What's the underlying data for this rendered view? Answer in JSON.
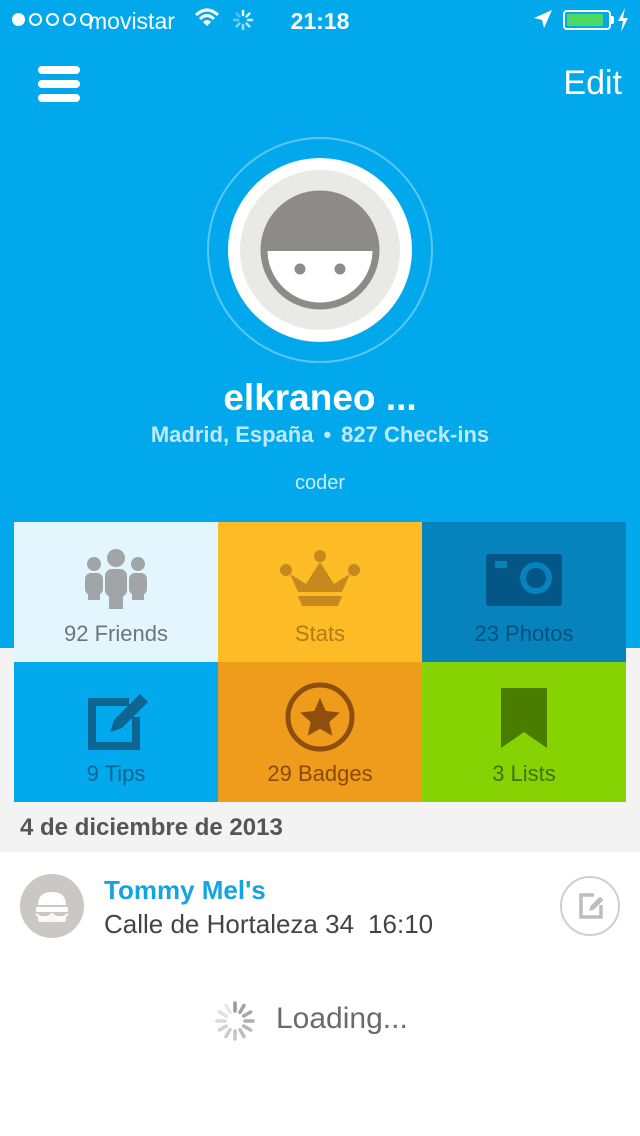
{
  "status_bar": {
    "carrier": "movistar",
    "time": "21:18",
    "signal_dots_filled": 1,
    "signal_dots_total": 5,
    "battery_level": 0.9,
    "battery_color": "#4cd964",
    "wifi_icon": "wifi-icon",
    "activity_icon": "activity-spinner-icon",
    "location_icon": "location-arrow-icon",
    "charging_icon": "charging-bolt-icon"
  },
  "nav": {
    "menu_icon": "hamburger-menu-icon",
    "edit_label": "Edit"
  },
  "profile": {
    "name": "elkraneo ...",
    "location": "Madrid, España",
    "separator": "•",
    "checkins": "827 Check-ins",
    "bio": "coder",
    "avatar_icon": "default-avatar-icon"
  },
  "tiles": [
    {
      "label": "92 Friends",
      "icon": "friends-icon",
      "color": "#e3f6fe"
    },
    {
      "label": "Stats",
      "icon": "crown-icon",
      "color": "#fdbc26"
    },
    {
      "label": "23 Photos",
      "icon": "camera-icon",
      "color": "#0683bc"
    },
    {
      "label": "9 Tips",
      "icon": "edit-tip-icon",
      "color": "#02a9ec"
    },
    {
      "label": "29 Badges",
      "icon": "star-badge-icon",
      "color": "#ef9b1c"
    },
    {
      "label": "3 Lists",
      "icon": "bookmark-icon",
      "color": "#86d202"
    }
  ],
  "feed": {
    "date": "4 de diciembre de 2013",
    "checkins": [
      {
        "venue": "Tommy Mel's",
        "address": "Calle de Hortaleza 34",
        "time": "16:10",
        "icon": "burger-icon",
        "action_icon": "add-tip-icon"
      }
    ],
    "loading_text": "Loading..."
  },
  "colors": {
    "header": "#01a9ec",
    "accent": "#13a5e1"
  }
}
